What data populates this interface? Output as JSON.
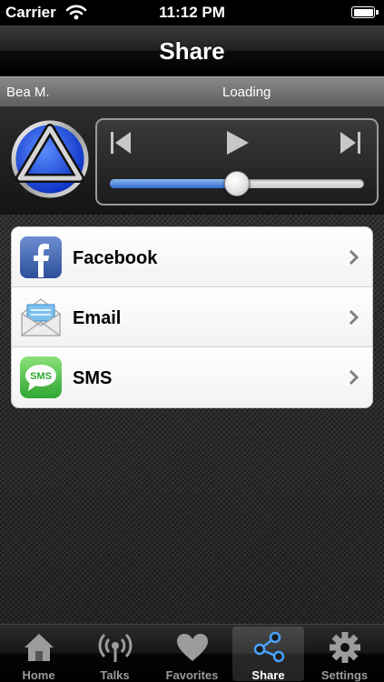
{
  "status_bar": {
    "carrier": "Carrier",
    "time": "11:12 PM"
  },
  "nav": {
    "title": "Share"
  },
  "now_playing": {
    "speaker": "Bea M.",
    "status": "Loading"
  },
  "player": {
    "progress": 0.5,
    "accent_color": "#2f6bd0"
  },
  "share_options": [
    {
      "label": "Facebook",
      "icon": "facebook-icon"
    },
    {
      "label": "Email",
      "icon": "email-envelope-icon"
    },
    {
      "label": "SMS",
      "icon": "sms-bubble-icon",
      "icon_text": "SMS"
    }
  ],
  "tabs": [
    {
      "label": "Home",
      "icon": "house-icon",
      "active": false
    },
    {
      "label": "Talks",
      "icon": "broadcast-icon",
      "active": false
    },
    {
      "label": "Favorites",
      "icon": "heart-icon",
      "active": false
    },
    {
      "label": "Share",
      "icon": "share-network-icon",
      "active": true
    },
    {
      "label": "Settings",
      "icon": "gear-icon",
      "active": false
    }
  ]
}
